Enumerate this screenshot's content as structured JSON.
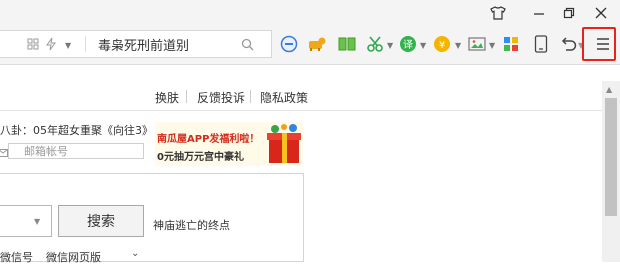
{
  "toolbar": {
    "address_text": "毒枭死刑前道别"
  },
  "icons": {
    "shirt": "shirt-icon",
    "minimize": "minimize-icon",
    "restore": "restore-icon",
    "close": "close-icon",
    "grid": "grid-icon",
    "lightning": "lightning-icon",
    "search": "search-icon",
    "menu": "menu-icon"
  },
  "page": {
    "top_links": [
      "换肤",
      "反馈投诉",
      "隐私政策"
    ],
    "gossip": "八卦：05年超女重聚《向往3》",
    "email_placeholder": "邮箱帐号",
    "ad": {
      "line1": "南瓜屋APP发福利啦！",
      "line2": "0元抽万元宫中豪礼"
    },
    "search_button": "搜索",
    "hot_search": "神庙逃亡的终点",
    "bottom_links": [
      "微信号",
      "微信网页版"
    ]
  },
  "colors": {
    "highlight_border": "#e8231c",
    "toolbar_bg": "#f4f4f4"
  }
}
